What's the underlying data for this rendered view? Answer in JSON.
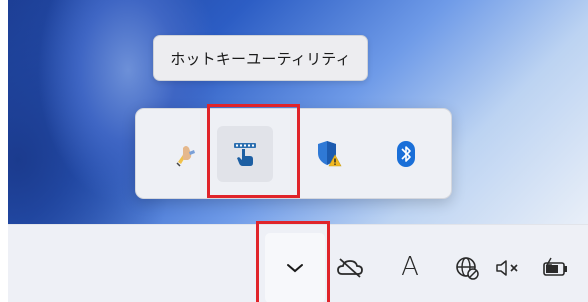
{
  "tooltip": {
    "text": "ホットキーユーティリティ"
  },
  "flyout": {
    "icons": [
      {
        "name": "pen-hand-icon"
      },
      {
        "name": "hotkey-utility-icon"
      },
      {
        "name": "security-warning-icon"
      },
      {
        "name": "bluetooth-icon"
      }
    ]
  },
  "taskbar": {
    "chevron": "chevron-up-icon",
    "ime_label": "A",
    "icons": [
      "show-hidden-icons",
      "onedrive-offline-icon",
      "ime-mode",
      "network-disconnected-icon",
      "volume-muted-icon",
      "battery-charging-icon"
    ]
  },
  "colors": {
    "highlight": "#e0242a",
    "bluetooth": "#1a6fd8",
    "shield": "#2f79d6",
    "warning": "#f2b922"
  }
}
